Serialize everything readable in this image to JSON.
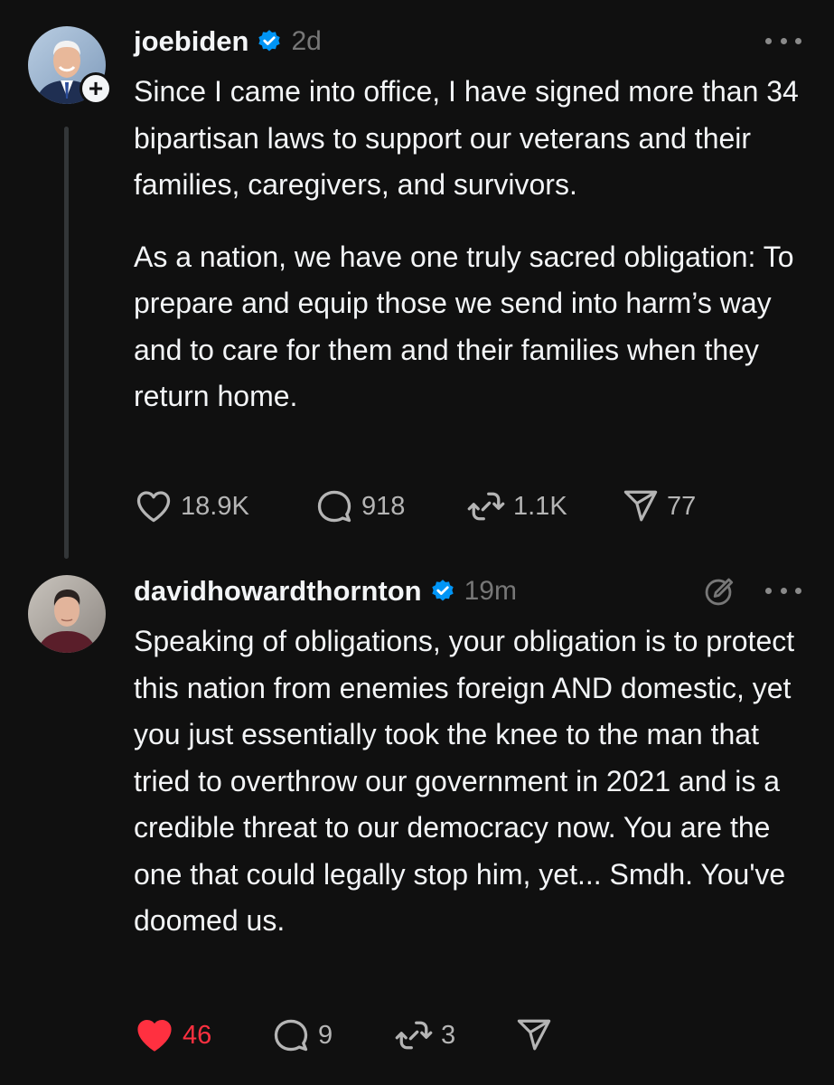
{
  "posts": [
    {
      "username": "joebiden",
      "timestamp": "2d",
      "verified": true,
      "paragraphs": [
        "Since I came into office, I have signed more than 34 bipartisan laws to support our veterans and their families, caregivers, and survivors.",
        "As a nation, we have one truly sacred obligation: To prepare and equip those we send into harm’s way and to care for them and their families when they return home."
      ],
      "likes": "18.9K",
      "replies": "918",
      "reposts": "1.1K",
      "shares": "77",
      "liked": false
    },
    {
      "username": "davidhowardthornton",
      "timestamp": "19m",
      "verified": true,
      "paragraphs": [
        "Speaking of obligations, your obligation is to protect this nation from enemies foreign AND domestic, yet you just essentially took the knee to the man that tried to overthrow our government in 2021 and is a credible threat to our democracy now. You are the one that could legally stop him, yet... Smdh. You've doomed us."
      ],
      "likes": "46",
      "replies": "9",
      "reposts": "3",
      "liked": true
    }
  ],
  "icons": {
    "verified": "verified-badge-icon",
    "like": "heart-icon",
    "reply": "speech-bubble-icon",
    "repost": "repost-arrows-icon",
    "share": "paper-plane-icon",
    "more": "more-dots-icon",
    "edit": "edit-pencil-icon",
    "follow": "plus-icon"
  },
  "colors": {
    "background": "#101010",
    "text": "#f3f5f7",
    "muted": "#777777",
    "verified": "#0095f6",
    "liked": "#ff3040"
  }
}
